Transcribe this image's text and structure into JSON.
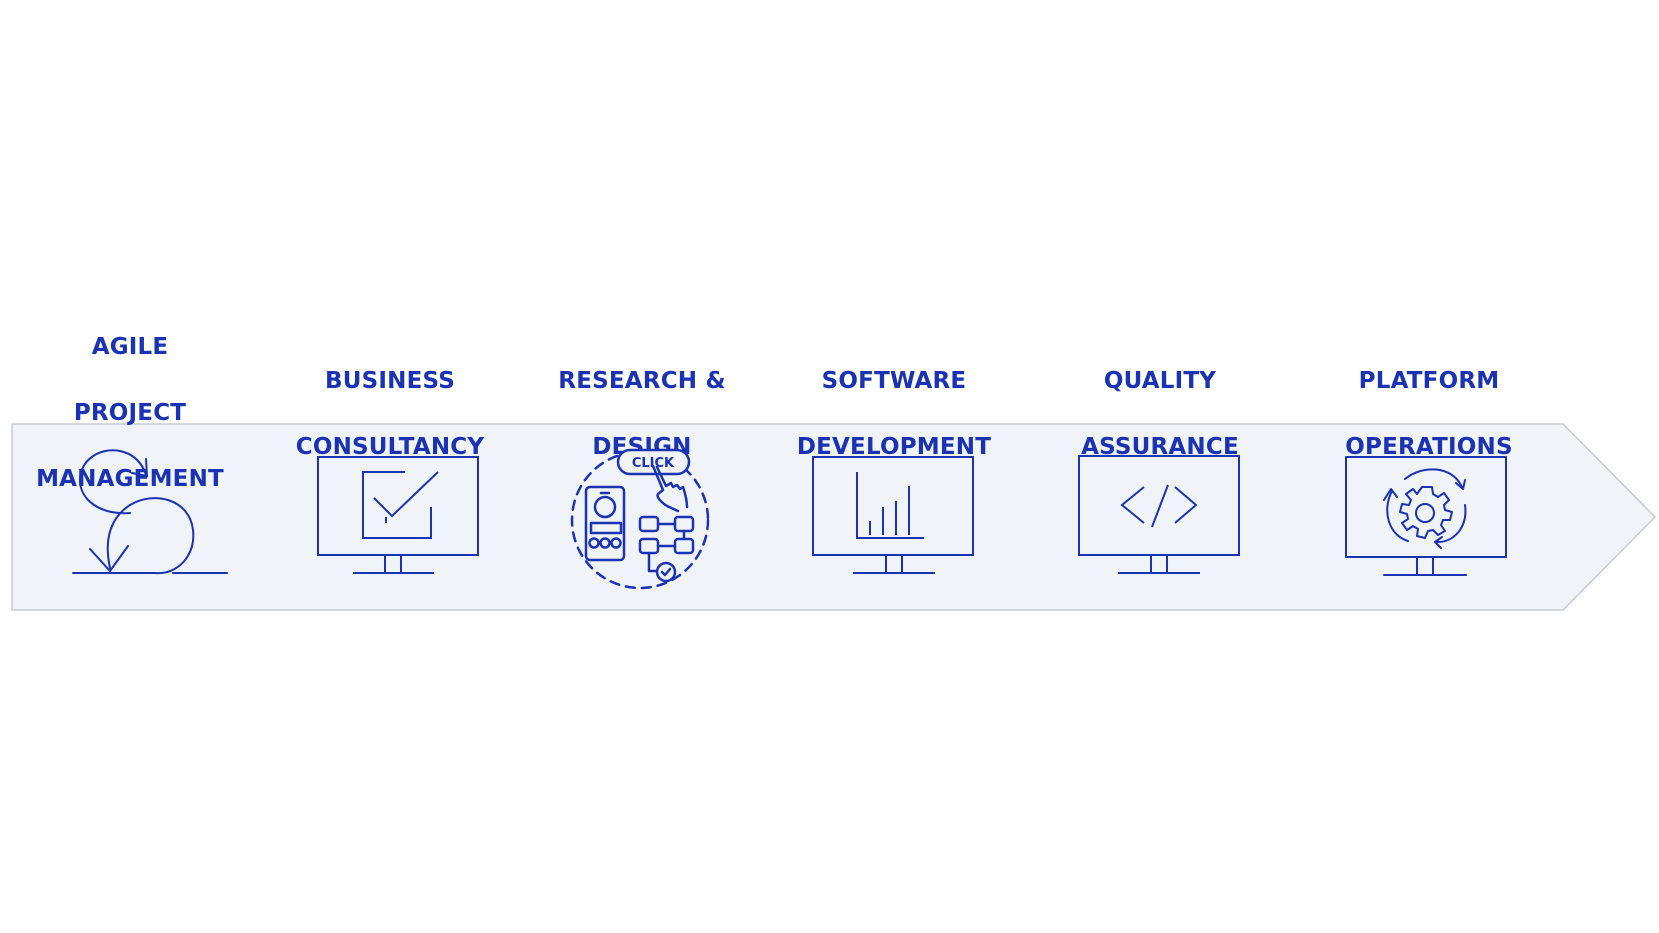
{
  "diagram": {
    "type": "process-arrow",
    "colors": {
      "accent": "#1a32b4",
      "band_fill": "#f0f3f7",
      "band_stroke": "#c8cbd0",
      "background": "#ffffff"
    },
    "steps": [
      {
        "title_lines": [
          "AGILE",
          "PROJECT",
          "MANAGEMENT"
        ],
        "icon": "agile-cycle-icon"
      },
      {
        "title_lines": [
          "BUSINESS",
          "CONSULTANCY"
        ],
        "icon": "monitor-checkmark-icon"
      },
      {
        "title_lines": [
          "RESEARCH &",
          "DESIGN"
        ],
        "icon": "ux-research-click-icon",
        "icon_text": "CLICK"
      },
      {
        "title_lines": [
          "SOFTWARE",
          "DEVELOPMENT"
        ],
        "icon": "monitor-bar-chart-icon"
      },
      {
        "title_lines": [
          "QUALITY",
          "ASSURANCE"
        ],
        "icon": "monitor-code-icon"
      },
      {
        "title_lines": [
          "PLATFORM",
          "OPERATIONS"
        ],
        "icon": "monitor-gear-cycle-icon"
      }
    ]
  }
}
